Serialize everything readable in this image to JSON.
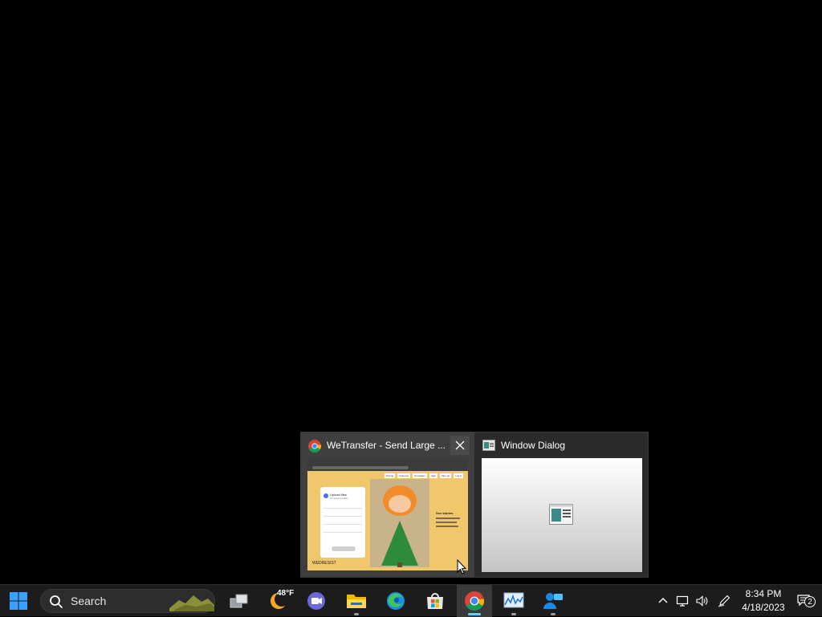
{
  "thumbnails": [
    {
      "title": "WeTransfer - Send Large ...",
      "app_icon": "chrome-icon",
      "close_icon": "close-icon"
    },
    {
      "title": "Window Dialog",
      "app_icon": "window-dialog-icon"
    }
  ],
  "wetransfer_preview": {
    "panel_title": "Upload files",
    "panel_subtitle": "Or select a folder",
    "side_heading": "See stories",
    "brand_text": "WEDRESIST",
    "nav_items": [
      "Pricing",
      "Features",
      "Templates",
      "Help",
      "Sign up",
      "Log in"
    ]
  },
  "taskbar": {
    "search_placeholder": "Search",
    "weather_temp": "48°F",
    "apps": [
      "start-icon",
      "task-view-icon",
      "weather-icon",
      "teams-chat-icon",
      "file-explorer-icon",
      "edge-icon",
      "microsoft-store-icon",
      "chrome-icon",
      "resource-monitor-icon",
      "people-icon"
    ],
    "active_app": "chrome",
    "clock_time": "8:34 PM",
    "clock_date": "4/18/2023",
    "notification_count": "2",
    "accent_color": "#60cdff"
  }
}
